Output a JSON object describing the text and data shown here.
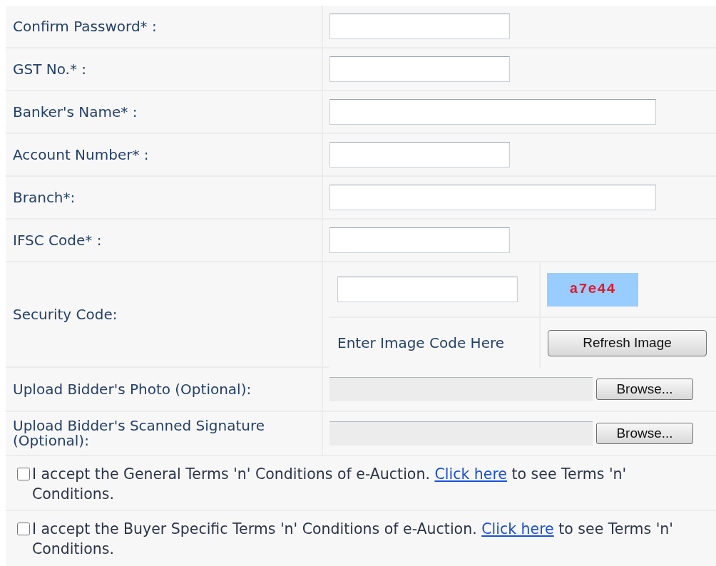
{
  "fields": [
    {
      "label": "Confirm Password* :",
      "kind": "short"
    },
    {
      "label": "GST No.* :",
      "kind": "short"
    },
    {
      "label": "Banker's Name* :",
      "kind": "long"
    },
    {
      "label": "Account Number* :",
      "kind": "short"
    },
    {
      "label": "Branch*:",
      "kind": "long"
    },
    {
      "label": "IFSC Code* :",
      "kind": "short"
    }
  ],
  "security": {
    "label": "Security Code:",
    "image_code": "a7e44",
    "hint": "Enter Image Code Here",
    "button": "Refresh Image"
  },
  "uploads": [
    {
      "label": "Upload Bidder's Photo (Optional):",
      "button": "Browse..."
    },
    {
      "label": "Upload Bidder's Scanned Signature (Optional):",
      "button": "Browse..."
    }
  ],
  "terms": [
    {
      "checked": false,
      "text_before": "I accept the General Terms 'n' Conditions of e-Auction.",
      "link": "Click here",
      "text_after": "to see Terms 'n' Conditions."
    },
    {
      "checked": false,
      "text_before": "I accept the Buyer Specific Terms 'n' Conditions of e-Auction.",
      "link": "Click here",
      "text_after": "to see Terms 'n' Conditions."
    }
  ]
}
